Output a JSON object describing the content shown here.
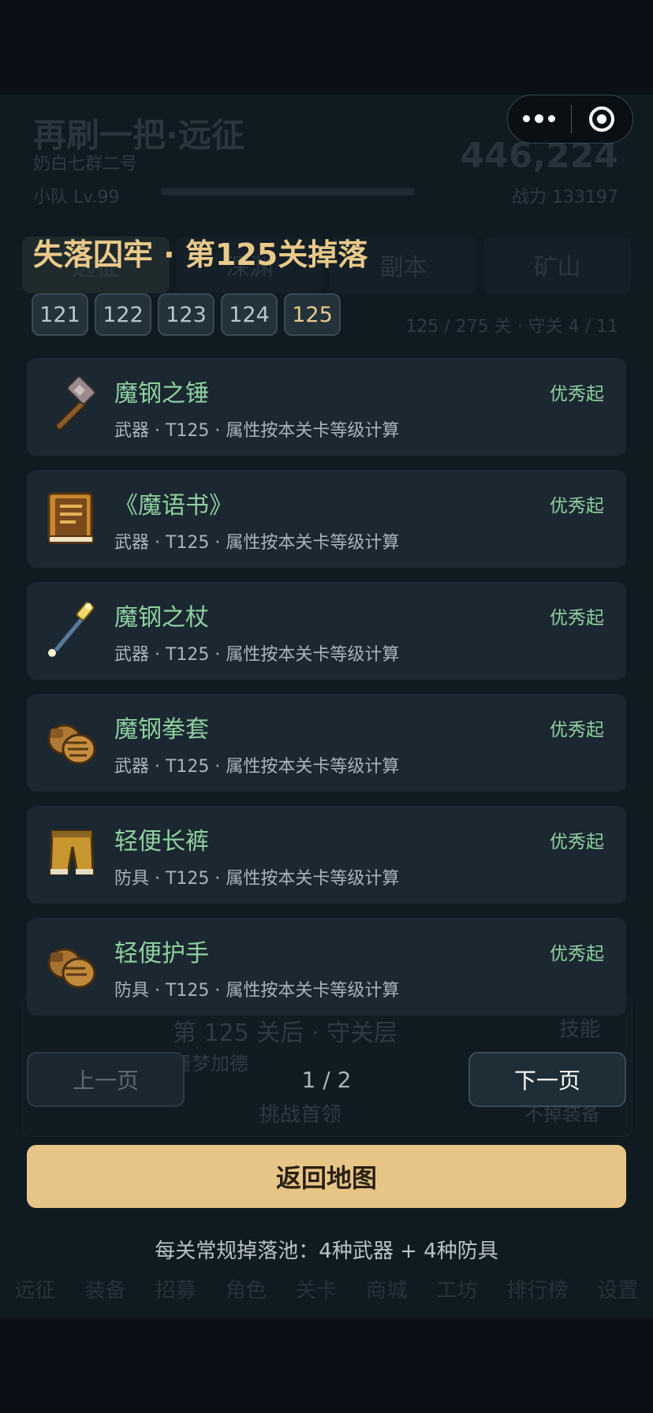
{
  "background": {
    "title": "再刷一把·远征",
    "team_name": "奶白七群二号",
    "team_level": "小队 Lv.99",
    "power_value": "446,224",
    "power_label": "战力 133197",
    "tabs": [
      "远征",
      "深渊",
      "副本",
      "矿山"
    ],
    "progress": "125 / 275 关 · 守关 4 / 11",
    "panel_title": "第 125 关后 · 守关层",
    "panel_subtitle": "噩梦加德",
    "panel_tag": "技能",
    "panel_button": "挑战首领",
    "panel_note": "不掉装备",
    "bottom_nav": [
      "远征",
      "装备",
      "招募",
      "角色",
      "关卡",
      "商城",
      "工坊",
      "排行榜",
      "设置"
    ]
  },
  "modal": {
    "title": "失落囚牢 · 第125关掉落",
    "stage_chips": [
      {
        "label": "121",
        "active": false
      },
      {
        "label": "122",
        "active": false
      },
      {
        "label": "123",
        "active": false
      },
      {
        "label": "124",
        "active": false
      },
      {
        "label": "125",
        "active": true
      }
    ],
    "items": [
      {
        "name": "魔钢之锤",
        "meta": "武器 · T125 · 属性按本关卡等级计算",
        "grade": "优秀起",
        "icon": "hammer-icon"
      },
      {
        "name": "《魔语书》",
        "meta": "武器 · T125 · 属性按本关卡等级计算",
        "grade": "优秀起",
        "icon": "book-icon"
      },
      {
        "name": "魔钢之杖",
        "meta": "武器 · T125 · 属性按本关卡等级计算",
        "grade": "优秀起",
        "icon": "staff-icon"
      },
      {
        "name": "魔钢拳套",
        "meta": "武器 · T125 · 属性按本关卡等级计算",
        "grade": "优秀起",
        "icon": "gauntlet-icon"
      },
      {
        "name": "轻便长裤",
        "meta": "防具 · T125 · 属性按本关卡等级计算",
        "grade": "优秀起",
        "icon": "pants-icon"
      },
      {
        "name": "轻便护手",
        "meta": "防具 · T125 · 属性按本关卡等级计算",
        "grade": "优秀起",
        "icon": "gloves-icon"
      }
    ],
    "pager": {
      "prev": "上一页",
      "next": "下一页",
      "info": "1 / 2"
    },
    "return_button": "返回地图",
    "footnote": "每关常规掉落池：4种武器 + 4种防具"
  },
  "colors": {
    "accent_gold": "#e9c98a",
    "item_green": "#8fd0a0",
    "button_gold": "#e7c587"
  }
}
